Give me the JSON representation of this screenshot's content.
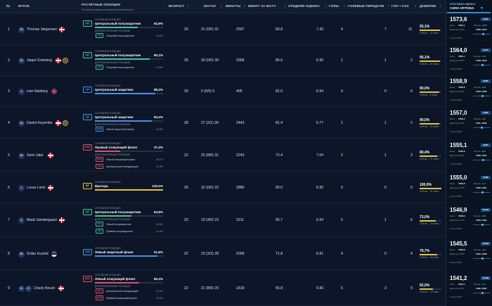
{
  "header": {
    "no": "№",
    "player": "ИГРОК",
    "positions": "РАСЧЁТНЫЕ ПОЗИЦИИ",
    "positions_sub": "Основная позиция и весомые дополнительные",
    "age": "ВОЗРАСТ",
    "matches": "МАТЧИ",
    "minutes": "МИНУТЫ",
    "min_per_match": "МИНУТ ЗА МАТЧ",
    "avg_rating": "СРЕДНЯЯ ОЦЕНКА",
    "goals": "ГОЛЫ",
    "assists": "ГОЛЕВЫЕ ПЕРЕДАЧИ",
    "ga": "ГОЛ + ПАС",
    "trust": "ДОВЕРИЕ",
    "strength_top": "ИТОГОВАЯ ОЦЕНКА",
    "strength": "СИЛА ИГРОКА",
    "sort_icon": "⇕",
    "sort_active": "▼"
  },
  "labels": {
    "main_pos": "ОСНОВНАЯ ПОЗИЦИЯ",
    "extra_pos": "ДОПОЛНИТЕЛЬНЫЕ ПОЗИЦИИ",
    "base": "База",
    "form": "Форма",
    "range": "Диапазон 80%",
    "season": "Сезон 25/26"
  },
  "rows": [
    {
      "no": "1",
      "num": "19",
      "name": "Thomas Jørgensen",
      "flag": "dk",
      "k": false,
      "pos_code": "ЦП",
      "pos_color": "#43c59e",
      "pos_name": "Центральный полузащитник",
      "pos_pct": "62,6%",
      "pos_frac": 0.626,
      "alts": [
        {
          "code": "ОП",
          "color": "#43c59e",
          "name": "Опорный полузащитник",
          "pct": "19,6%"
        }
      ],
      "age": "20",
      "matches": "31 (0/0) 31",
      "minutes": "2597",
      "mpm": "83.8",
      "rating": "7.42",
      "goals": "4",
      "assists": "7",
      "ga": "11",
      "trust_pct": "93,1%",
      "trust_frac": 0.931,
      "trust_sub": "Сейчас – 32 запп.",
      "str": "1573,6",
      "rank": "№29",
      "base": "1561,1",
      "form": "+12,5",
      "form_color": "#4ddb8a",
      "range": "1528–1619",
      "season": "Сезон 25/26",
      "slider": 0.55
    },
    {
      "no": "2",
      "num": "13",
      "name": "Jeppe Grønning",
      "flag": "dk",
      "k": true,
      "pos_code": "ЦП",
      "pos_color": "#43c59e",
      "pos_name": "Центральный полузащитник",
      "pos_pct": "80,1%",
      "pos_frac": 0.801,
      "alts": [
        {
          "code": "ОП",
          "color": "#43c59e",
          "name": "Опорный полузащитник",
          "pct": "12,6%"
        }
      ],
      "age": "35",
      "matches": "30 (0/0) 30",
      "minutes": "2568",
      "mpm": "85.6",
      "rating": "6.95",
      "goals": "1",
      "assists": "1",
      "ga": "2",
      "trust_pct": "95,1%",
      "trust_frac": 0.951,
      "trust_sub": "Сейчас – 30 зимн.",
      "str": "1564,0",
      "rank": "№75",
      "base": "1562,1",
      "form": "+1,9",
      "form_color": "#4ddb8a",
      "range": "1518–1610",
      "season": "Сезон 25/26",
      "slider": 0.5
    },
    {
      "no": "3",
      "num": "2",
      "name": "Ivan Näsberg",
      "flag": "uk",
      "k": false,
      "pos_code": "ЦЗ",
      "pos_color": "#4a90e2",
      "pos_name": "Центральный защитник",
      "pos_pct": "88,2%",
      "pos_frac": 0.882,
      "alts": [],
      "age": "30",
      "matches": "5 (0/0) 5",
      "minutes": "405",
      "mpm": "81.0",
      "rating": "6.94",
      "goals": "0",
      "assists": "0",
      "ga": "0",
      "trust_pct": "90,0%",
      "trust_frac": 0.9,
      "trust_sub": "Сейчас – 5 зимн.",
      "str": "1558,9",
      "rank": "№80",
      "base": "1558,9",
      "form": "+0,0",
      "form_color": "#4ddb8a",
      "range": "1513–1606",
      "season": "Сезон 25/26",
      "slider": 0.5
    },
    {
      "no": "4",
      "num": "24",
      "name": "Daniel Anyembe",
      "flag": "dk",
      "k": true,
      "pos_code": "ЦЗ",
      "pos_color": "#4a90e2",
      "pos_name": "Центральный защитник",
      "pos_pct": "83,4%",
      "pos_frac": 0.834,
      "alts": [
        {
          "code": "ЛЗФ",
          "color": "#4a90e2",
          "name": "Левый защитный фланг",
          "pct": "10,9%"
        }
      ],
      "age": "28",
      "matches": "27 (2/1) 30",
      "minutes": "2443",
      "mpm": "81.4",
      "rating": "6.77",
      "goals": "1",
      "assists": "1",
      "ga": "2",
      "trust_pct": "90,5%",
      "trust_frac": 0.905,
      "trust_sub": "Сейчас – 30 зимн.",
      "str": "1557,0",
      "rank": "№82",
      "base": "1559,2",
      "form": "–2,2",
      "form_color": "#f0a040",
      "range": "1511–1603",
      "season": "Сезон 25/26",
      "slider": 0.45
    },
    {
      "no": "5",
      "num": "29",
      "name": "Sami Jalal",
      "flag": "dk",
      "k": false,
      "pos_code": "ПАФ",
      "pos_color": "#e0506a",
      "pos_name": "Правый атакующий фланг",
      "pos_pct": "37,4%",
      "pos_frac": 0.374,
      "alts": [
        {
          "code": "ЛАФ",
          "color": "#e0506a",
          "name": "Левый атакующий фланг",
          "pct": "36,1%"
        },
        {
          "code": "ЦН",
          "color": "#e0506a",
          "name": "Центральный нападающий",
          "pct": "11,9%"
        }
      ],
      "age": "22",
      "matches": "25 (8/0) 31",
      "minutes": "2243",
      "mpm": "72.4",
      "rating": "7.04",
      "goals": "2",
      "assists": "1",
      "ga": "3",
      "trust_pct": "80,4%",
      "trust_frac": 0.804,
      "trust_sub": "Сейчас – 31 зимн.",
      "str": "1555,1",
      "rank": "№87",
      "base": "1546,9",
      "form": "+8,2",
      "form_color": "#4ddb8a",
      "range": "1509–1601",
      "season": "Сезон 25/26",
      "slider": 0.55
    },
    {
      "no": "6",
      "num": "1",
      "name": "Lucas Lund",
      "flag": "dk",
      "k": false,
      "pos_code": "ВР",
      "pos_color": "#e8c33a",
      "pos_name": "Вратарь",
      "pos_pct": "100,0%",
      "pos_frac": 1.0,
      "alts": [],
      "age": "26",
      "matches": "32 (0/0) 32",
      "minutes": "2880",
      "mpm": "90.0",
      "rating": "6.95",
      "goals": "0",
      "assists": "0",
      "ga": "0",
      "trust_pct": "100,0%",
      "trust_frac": 1.0,
      "trust_sub": "Сейчас – 32 зимн.",
      "str": "1555,0",
      "rank": "№88",
      "base": "1553,9",
      "form": "+1,1",
      "form_color": "#4ddb8a",
      "range": "1509–1601",
      "season": "Сезон 25/26",
      "slider": 0.5
    },
    {
      "no": "7",
      "num": "8",
      "name": "Mads Søndergaard",
      "flag": "dk",
      "k": false,
      "pos_code": "ЦП",
      "pos_color": "#43c59e",
      "pos_name": "Центральный полузащитник",
      "pos_pct": "53,8%",
      "pos_frac": 0.538,
      "alts": [
        {
          "code": "ЛП",
          "color": "#43c59e",
          "name": "Левый полузащитник",
          "pct": "18,5%"
        },
        {
          "code": "ПП",
          "color": "#43c59e",
          "name": "Правый полузащитник",
          "pct": "14,3%"
        }
      ],
      "age": "23",
      "matches": "19 (4/0) 23",
      "minutes": "1511",
      "mpm": "65.7",
      "rating": "6.94",
      "goals": "5",
      "assists": "1",
      "ga": "6",
      "trust_pct": "73,0%",
      "trust_frac": 0.73,
      "trust_sub": "Сейчас – 23 зимн.",
      "str": "1546,9",
      "rank": "№125",
      "base": "1546,9",
      "form": "+0,0",
      "form_color": "#4ddb8a",
      "range": "1503–1590",
      "season": "Сезон 25/26",
      "slider": 0.5
    },
    {
      "no": "8",
      "num": "30",
      "name": "Srđan Kuzmić",
      "flag": "rs",
      "k": false,
      "pos_code": "ЛЗФ",
      "pos_color": "#4a90e2",
      "pos_name": "Левый защитный фланг",
      "pos_pct": "91,8%",
      "pos_frac": 0.918,
      "alts": [],
      "age": "22",
      "matches": "23 (3/2) 28",
      "minutes": "2009",
      "mpm": "71.8",
      "rating": "6.91",
      "goals": "4",
      "assists": "0",
      "ga": "4",
      "trust_pct": "79,7%",
      "trust_frac": 0.797,
      "trust_sub": "Сейчас – 28 зимн.",
      "str": "1545,5",
      "rank": "№126",
      "base": "1545,6",
      "form": "–0,1",
      "form_color": "#f0a040",
      "range": "1502–1589",
      "season": "Сезон 25/26",
      "slider": 0.5
    },
    {
      "no": "9",
      "num": "17",
      "name": "Charly Nouck",
      "flag": "dk",
      "k": false,
      "extra_num": "11",
      "pos_code": "ЛАФ",
      "pos_color": "#e0506a",
      "pos_name": "Левый атакующий фланг",
      "pos_pct": "65,3%",
      "pos_frac": 0.653,
      "alts": [
        {
          "code": "ЦН",
          "color": "#e0506a",
          "name": "Центральный нападающий",
          "pct": "16,4%"
        },
        {
          "code": "ПАФ",
          "color": "#e0506a",
          "name": "Правый атакующий фланг",
          "pct": "15,0%"
        }
      ],
      "age": "22",
      "matches": "21 (8/0) 29",
      "minutes": "1818",
      "mpm": "55.8",
      "rating": "6.96",
      "goals": "6",
      "assists": "3",
      "ga": "9",
      "trust_pct": "62,0%",
      "trust_frac": 0.62,
      "trust_sub": "Сейчас – 29 зимн.",
      "str": "1541,2",
      "rank": "№138",
      "base": "1540,1",
      "form": "+1,1",
      "form_color": "#4ddb8a",
      "range": "1495–1587",
      "season": "Сезон 25/26",
      "slider": 0.5
    }
  ]
}
